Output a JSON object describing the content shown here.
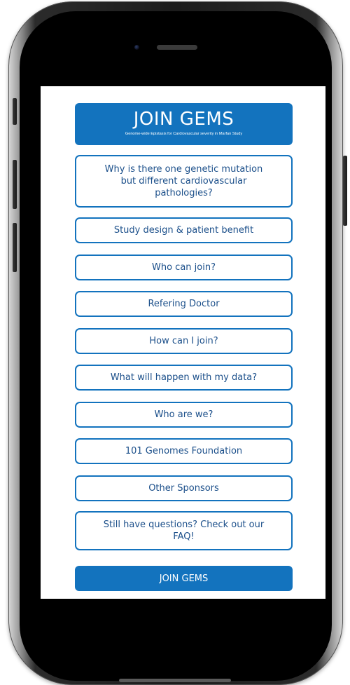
{
  "banner": {
    "title": "JOIN GEMS",
    "subtitle": "Genome-wide Epistasis for Cardiovascular severity in Marfan Study"
  },
  "menu": {
    "items": [
      {
        "label": "Why is there one genetic mutation but different cardiovascular pathologies?"
      },
      {
        "label": "Study design & patient benefit"
      },
      {
        "label": "Who can join?"
      },
      {
        "label": "Refering Doctor"
      },
      {
        "label": "How can I join?"
      },
      {
        "label": "What will happen with my data?"
      },
      {
        "label": "Who are we?"
      },
      {
        "label": "101 Genomes Foundation"
      },
      {
        "label": "Other Sponsors"
      },
      {
        "label": "Still have questions? Check out our FAQ!"
      }
    ]
  },
  "cta": {
    "label": "JOIN GEMS"
  },
  "colors": {
    "accent": "#1373be",
    "text": "#1b4f8a",
    "background": "#ffffff",
    "frame": "#000000"
  }
}
